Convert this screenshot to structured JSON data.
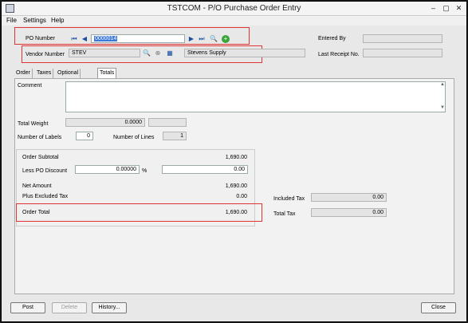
{
  "window": {
    "title": "TSTCOM - P/O Purchase Order Entry",
    "minimize": "–",
    "restore": "▢",
    "close": "✕"
  },
  "menu": [
    {
      "label": "File"
    },
    {
      "label": "Settings"
    },
    {
      "label": "Help"
    }
  ],
  "header": {
    "po_number_label": "PO Number",
    "po_number_value": "0000014",
    "vendor_number_label": "Vendor Number",
    "vendor_number_value": "STEV",
    "vendor_name": "Stevens Supply",
    "entered_by_label": "Entered By",
    "entered_by_value": "",
    "last_receipt_label": "Last Receipt No.",
    "last_receipt_value": ""
  },
  "tabs": [
    {
      "label": "Order"
    },
    {
      "label": "Taxes"
    },
    {
      "label": "Optional Fields"
    },
    {
      "label": "Totals"
    }
  ],
  "totals": {
    "comment_label": "Comment",
    "comment_value": "",
    "total_weight_label": "Total Weight",
    "total_weight_value": "0.0000",
    "total_weight_unit": "",
    "number_of_labels_label": "Number of Labels",
    "number_of_labels_value": "0",
    "number_of_lines_label": "Number of Lines",
    "number_of_lines_value": "1",
    "order_subtotal_label": "Order Subtotal",
    "order_subtotal_value": "1,690.00",
    "less_po_discount_label": "Less PO Discount",
    "discount_percent_value": "0.00000",
    "percent_sign": "%",
    "discount_amount_value": "0.00",
    "net_amount_label": "Net Amount",
    "net_amount_value": "1,690.00",
    "plus_excluded_tax_label": "Plus Excluded Tax",
    "plus_excluded_tax_value": "0.00",
    "order_total_label": "Order Total",
    "order_total_value": "1,690.00",
    "included_tax_label": "Included Tax",
    "included_tax_value": "0.00",
    "total_tax_label": "Total Tax",
    "total_tax_value": "0.00"
  },
  "buttons": {
    "post": "Post",
    "delete": "Delete",
    "history": "History...",
    "close": "Close"
  },
  "colors": {
    "highlight_box": "#e03333",
    "nav_blue": "#1b4f9c",
    "new_green": "#3aa53a"
  }
}
